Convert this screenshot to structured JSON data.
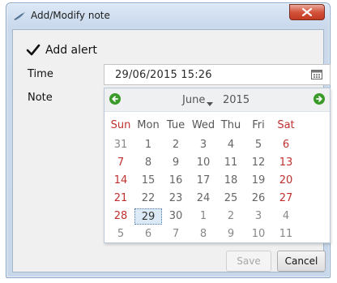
{
  "window": {
    "title": "Add/Modify note"
  },
  "form": {
    "alert_label": "Add alert",
    "alert_checked": true,
    "time_label": "Time",
    "time_value": "29/06/2015 15:26",
    "note_label": "Note"
  },
  "calendar": {
    "month": "June",
    "year": "2015",
    "weekdays": [
      "Sun",
      "Mon",
      "Tue",
      "Wed",
      "Thu",
      "Fri",
      "Sat"
    ],
    "weeks": [
      [
        "31",
        "1",
        "2",
        "3",
        "4",
        "5",
        "6"
      ],
      [
        "7",
        "8",
        "9",
        "10",
        "11",
        "12",
        "13"
      ],
      [
        "14",
        "15",
        "16",
        "17",
        "18",
        "19",
        "20"
      ],
      [
        "21",
        "22",
        "23",
        "24",
        "25",
        "26",
        "27"
      ],
      [
        "28",
        "29",
        "30",
        "1",
        "2",
        "3",
        "4"
      ],
      [
        "5",
        "6",
        "7",
        "8",
        "9",
        "10",
        "11"
      ]
    ],
    "selected_day": "29",
    "colors": {
      "weekend": "#c03030",
      "nav_green": "#3a9a2a",
      "selected_bg": "#dbeaf6"
    }
  },
  "buttons": {
    "save_label": "Save",
    "save_enabled": false,
    "cancel_label": "Cancel"
  },
  "icons": {
    "title": "feather-note-icon",
    "close": "close-icon",
    "calendar": "calendar-icon",
    "prev": "arrow-left-icon",
    "next": "arrow-right-icon"
  }
}
